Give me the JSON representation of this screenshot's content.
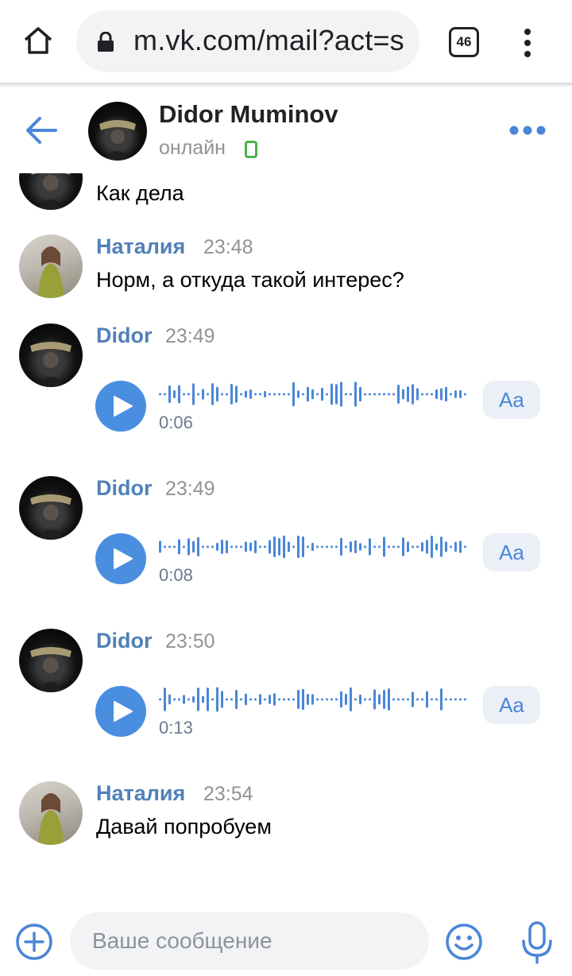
{
  "browser": {
    "url": "m.vk.com/mail?act=s",
    "tab_count": "46",
    "icons": {
      "home": "home-icon",
      "lock": "lock-icon",
      "menu": "more-vert-icon"
    }
  },
  "header": {
    "name": "Didor Muminov",
    "status": "онлайн",
    "icons": {
      "back": "arrow-left-icon",
      "mobile": "mobile-phone-icon",
      "more": "more-horiz-icon"
    }
  },
  "messages": [
    {
      "type": "text",
      "sender": "didor",
      "author": "",
      "time": "",
      "text": "Как дела"
    },
    {
      "type": "text",
      "sender": "natalia",
      "author": "Наталия",
      "time": "23:48",
      "text": "Норм, а откуда такой интерес?"
    },
    {
      "type": "voice",
      "sender": "didor",
      "author": "Didor",
      "time": "23:49",
      "duration": "0:06",
      "transcribe_label": "Aa"
    },
    {
      "type": "voice",
      "sender": "didor",
      "author": "Didor",
      "time": "23:49",
      "duration": "0:08",
      "transcribe_label": "Aa"
    },
    {
      "type": "voice",
      "sender": "didor",
      "author": "Didor",
      "time": "23:50",
      "duration": "0:13",
      "transcribe_label": "Aa"
    },
    {
      "type": "text",
      "sender": "natalia",
      "author": "Наталия",
      "time": "23:54",
      "text": "Давай попробуем"
    }
  ],
  "composer": {
    "placeholder": "Ваше сообщение",
    "icons": {
      "attach": "plus-circle-icon",
      "emoji": "smile-icon",
      "mic": "microphone-icon"
    }
  },
  "colors": {
    "accent": "#5181b8",
    "play": "#4a8ee0",
    "wave": "#4a86d8",
    "online": "#4bb34b"
  }
}
